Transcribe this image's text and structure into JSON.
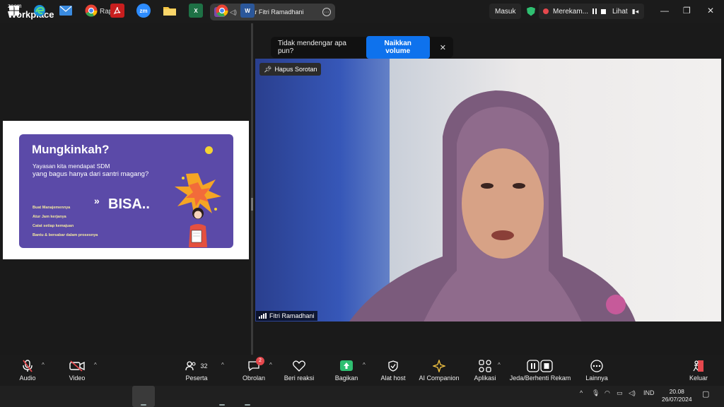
{
  "titlebar": {
    "brand_top": "zoom",
    "brand_bottom": "Workplace",
    "meeting_label": "Rapat",
    "share_avatar": "FR",
    "share_label": "Layar Fitri Ramadhani",
    "signin_label": "Masuk",
    "recording_label": "Merekam...",
    "view_label": "Lihat"
  },
  "banner": {
    "text": "Tidak mendengar apa pun?",
    "button": "Naikkan volume"
  },
  "slide": {
    "title": "Mungkinkah?",
    "subtitle_1": "Yayasan kita mendapat SDM",
    "subtitle_2": "yang bagus hanya dari santri magang?",
    "arrow": "»",
    "answer": "BISA..",
    "points": [
      "Buat Manajemennya",
      "Atur Jam kerjanya",
      "Catat setiap kemajuan",
      "Bantu & bersabar dalam prosesnya"
    ]
  },
  "video": {
    "spotlight_label": "Hapus Sorotan",
    "participant_name": "Fitri Ramadhani"
  },
  "toolbar": {
    "audio": "Audio",
    "video": "Video",
    "participants": "Peserta",
    "participants_count": "32",
    "chat": "Obrolan",
    "chat_badge": "2",
    "react": "Beri reaksi",
    "share": "Bagikan",
    "host_tools": "Alat host",
    "ai_companion": "AI Companion",
    "apps": "Aplikasi",
    "record": "Jeda/Berhenti Rekam",
    "more": "Lainnya",
    "leave": "Keluar"
  },
  "taskbar": {
    "zoom_app": "zm",
    "lang": "IND",
    "time": "20.08",
    "date": "26/07/2024"
  },
  "colors": {
    "accent_blue": "#0e72ed",
    "slide_purple": "#5b4aa8",
    "share_green": "#2fbf71",
    "alert_red": "#e5484d"
  }
}
